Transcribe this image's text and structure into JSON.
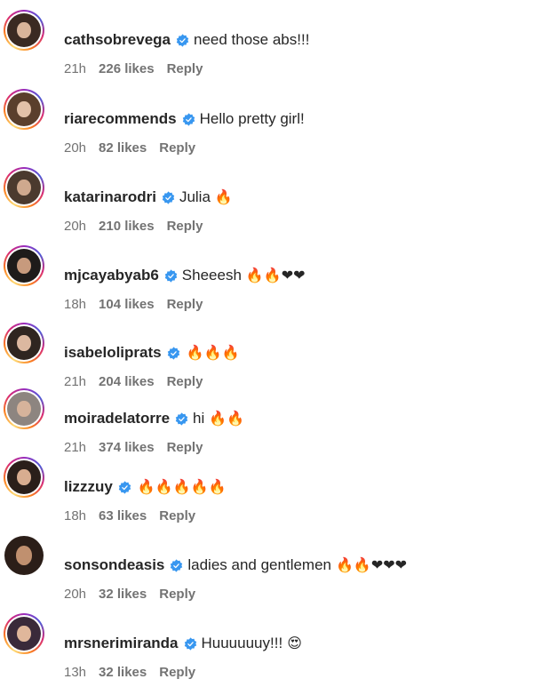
{
  "colors": {
    "verified": "#3897f0",
    "meta_text": "#737373",
    "username_text": "#262626"
  },
  "icons": {
    "verified": "verified-badge-icon",
    "fire": "🔥",
    "heart": "❤",
    "heart_eyes": "😍"
  },
  "comments": [
    {
      "username": "cathsobrevega",
      "text": "need those abs!!!",
      "emoji": "",
      "time": "21h",
      "likes": "226 likes",
      "reply": "Reply",
      "story_ring": true,
      "avatar_hair": "#3b2a22",
      "avatar_face": "#d9b49a"
    },
    {
      "username": "riarecommends",
      "text": "Hello pretty girl!",
      "emoji": "",
      "time": "20h",
      "likes": "82 likes",
      "reply": "Reply",
      "story_ring": true,
      "avatar_hair": "#5a3f2c",
      "avatar_face": "#e2c1a8"
    },
    {
      "username": "katarinarodri",
      "text": "Julia",
      "emoji": "🔥",
      "time": "20h",
      "likes": "210 likes",
      "reply": "Reply",
      "story_ring": true,
      "avatar_hair": "#4b3a2e",
      "avatar_face": "#cfa98e"
    },
    {
      "username": "mjcayabyab6",
      "text": "Sheeesh",
      "emoji": "🔥🔥❤❤",
      "time": "18h",
      "likes": "104 likes",
      "reply": "Reply",
      "story_ring": true,
      "avatar_hair": "#1e1b1a",
      "avatar_face": "#c79a7d"
    },
    {
      "username": "isabeloliprats",
      "text": "",
      "emoji": "🔥🔥🔥",
      "time": "21h",
      "likes": "204 likes",
      "reply": "Reply",
      "story_ring": true,
      "avatar_hair": "#2f2520",
      "avatar_face": "#dcb8a0"
    },
    {
      "username": "moiradelatorre",
      "text": "hi",
      "emoji": "🔥🔥",
      "time": "21h",
      "likes": "374 likes",
      "reply": "Reply",
      "story_ring": true,
      "avatar_hair": "#8d8580",
      "avatar_face": "#d6b39b"
    },
    {
      "username": "lizzzuy",
      "text": "",
      "emoji": "🔥🔥🔥🔥🔥",
      "time": "18h",
      "likes": "63 likes",
      "reply": "Reply",
      "story_ring": true,
      "avatar_hair": "#2a1f1a",
      "avatar_face": "#d8ad90"
    },
    {
      "username": "sonsondeasis",
      "text": "ladies and gentlemen",
      "emoji": "🔥🔥❤❤❤",
      "time": "20h",
      "likes": "32 likes",
      "reply": "Reply",
      "story_ring": false,
      "avatar_hair": "#2b1e18",
      "avatar_face": "#c0906f"
    },
    {
      "username": "mrsnerimiranda",
      "text": "Huuuuuuy!!!",
      "emoji": "😍",
      "time": "13h",
      "likes": "32 likes",
      "reply": "Reply",
      "story_ring": true,
      "avatar_hair": "#3a2a3a",
      "avatar_face": "#e0b79b"
    }
  ]
}
